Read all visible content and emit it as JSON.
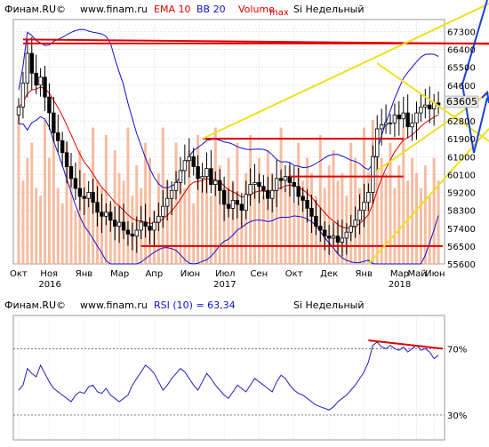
{
  "main_panel": {
    "header": {
      "source": "Финам.RU©",
      "site": "www.finam.ru",
      "ema": "EMA 10",
      "bb": "BB 20",
      "volume": "Volume",
      "max": "max",
      "instrument": "Si Недельный"
    },
    "last_price_label": "63605",
    "colors": {
      "candle": "#000000",
      "ema": "#e00000",
      "bollinger": "#1010d0",
      "volume": "#f4b090",
      "support_resistance": "#e00000",
      "channel": "#f0e020",
      "forecast_arrow": "#1a40e0",
      "price_tag": "#e8e8e8"
    }
  },
  "rsi_panel": {
    "header": {
      "source": "Финам.RU©",
      "site": "www.finam.ru",
      "indicator": "RSI (10) = 63,34",
      "instrument": "Si Недельный"
    },
    "colors": {
      "rsi": "#2020c0",
      "divergence": "#e00000",
      "levels": "#555555"
    }
  },
  "chart_data": [
    {
      "type": "candlestick",
      "instrument": "Si Недельный",
      "timeframe": "weekly",
      "x_ticks": [
        "Окт",
        "Ноя",
        "Янв",
        "Мар",
        "Апр",
        "Июн",
        "Июл",
        "Сен",
        "Окт",
        "Дек",
        "Янв",
        "Мар",
        "Май",
        "Июн"
      ],
      "x_year_labels": [
        "2016",
        "2017",
        "2018"
      ],
      "y_ticks": [
        55600,
        56500,
        57400,
        58300,
        59200,
        60100,
        61000,
        61900,
        62800,
        63700,
        64600,
        65500,
        66400,
        67300
      ],
      "ylim": [
        55600,
        67900
      ],
      "grid": true,
      "close": [
        63500,
        64700,
        66200,
        65200,
        64600,
        65000,
        64000,
        63200,
        62200,
        61800,
        61200,
        60500,
        59900,
        59400,
        59000,
        58900,
        59200,
        58700,
        58200,
        58000,
        58200,
        57800,
        57500,
        57700,
        57300,
        57100,
        57000,
        57300,
        57700,
        57500,
        57300,
        57700,
        58000,
        58500,
        58900,
        59300,
        59700,
        60300,
        60800,
        61000,
        60500,
        59900,
        60000,
        60400,
        59600,
        59800,
        59300,
        58600,
        58400,
        58800,
        58600,
        58300,
        59100,
        59600,
        59700,
        59500,
        59300,
        58900,
        59300,
        59900,
        59800,
        60000,
        59700,
        59500,
        59000,
        58800,
        58400,
        58000,
        57500,
        57300,
        57000,
        56900,
        57000,
        56700,
        56900,
        57200,
        57500,
        57800,
        58300,
        58700,
        59200,
        61000,
        62400,
        62600,
        62700,
        62700,
        63100,
        62900,
        63200,
        62500,
        62700,
        63200,
        63500,
        63600,
        63400,
        63700,
        63600
      ],
      "volume": [
        1.0,
        0.55,
        0.7,
        0.8,
        0.5,
        0.45,
        0.95,
        0.7,
        0.9,
        0.5,
        0.4,
        0.8,
        0.6,
        0.35,
        0.75,
        0.6,
        0.45,
        0.9,
        0.55,
        0.5,
        0.85,
        0.4,
        0.75,
        0.6,
        0.55,
        0.9,
        0.45,
        0.65,
        0.5,
        0.8,
        0.7,
        0.35,
        0.6,
        0.9,
        0.55,
        0.45,
        0.8,
        0.6,
        0.5,
        0.75,
        0.4,
        0.85,
        0.55,
        0.6,
        0.45,
        0.9,
        0.65,
        0.5,
        0.7,
        0.55,
        0.8,
        0.4,
        0.6,
        0.85,
        0.5,
        0.7,
        0.45,
        0.75,
        0.6,
        0.55,
        0.9,
        0.5,
        0.65,
        0.4,
        0.8,
        0.55,
        0.7,
        0.6,
        0.45,
        0.85,
        0.5,
        0.65,
        0.75,
        0.55,
        0.6,
        0.45,
        0.8,
        0.7,
        0.5,
        0.9,
        0.6,
        0.95,
        0.85,
        0.7,
        0.6,
        0.8,
        0.5,
        0.65,
        0.9,
        0.55,
        0.7,
        0.6,
        0.5,
        0.65,
        0.45,
        0.7,
        0.55
      ],
      "series": [
        {
          "name": "EMA 10"
        },
        {
          "name": "BB 20"
        },
        {
          "name": "Volume"
        }
      ],
      "annotations": {
        "horizontal_levels": [
          66700,
          61900,
          60000,
          56500
        ],
        "trendlines": [
          {
            "from": [
              42,
              61900
            ],
            "to": [
              97,
              67600
            ]
          },
          {
            "from": [
              80,
              55600
            ],
            "to": [
              97,
              59800
            ]
          },
          {
            "from": [
              82,
              65700
            ],
            "to": [
              97,
              63400
            ]
          },
          {
            "from": [
              82,
              60300
            ],
            "to": [
              97,
              62600
            ]
          },
          {
            "from": [
              1,
              66900
            ],
            "to": [
              97,
              66700
            ]
          }
        ]
      }
    },
    {
      "type": "line",
      "name": "RSI (10) = 63,34",
      "levels_labels": [
        "70%",
        "30%"
      ],
      "levels": [
        70,
        30
      ],
      "ylim": [
        15,
        90
      ],
      "values": [
        45,
        48,
        58,
        55,
        53,
        60,
        55,
        50,
        46,
        44,
        42,
        40,
        38,
        42,
        44,
        43,
        47,
        48,
        44,
        43,
        46,
        42,
        40,
        38,
        40,
        42,
        48,
        52,
        56,
        60,
        58,
        55,
        50,
        45,
        48,
        52,
        55,
        58,
        56,
        52,
        48,
        45,
        50,
        55,
        52,
        48,
        45,
        42,
        40,
        44,
        48,
        46,
        44,
        48,
        52,
        50,
        48,
        46,
        44,
        50,
        54,
        52,
        48,
        45,
        43,
        42,
        40,
        38,
        36,
        35,
        34,
        33,
        35,
        38,
        40,
        42,
        45,
        48,
        52,
        56,
        62,
        72,
        74,
        71,
        70,
        72,
        70,
        69,
        71,
        68,
        70,
        72,
        69,
        70,
        68,
        64,
        66
      ],
      "annotations": {
        "divergence_line": {
          "from": [
            80,
            75
          ],
          "to": [
            97,
            70
          ]
        }
      }
    }
  ]
}
